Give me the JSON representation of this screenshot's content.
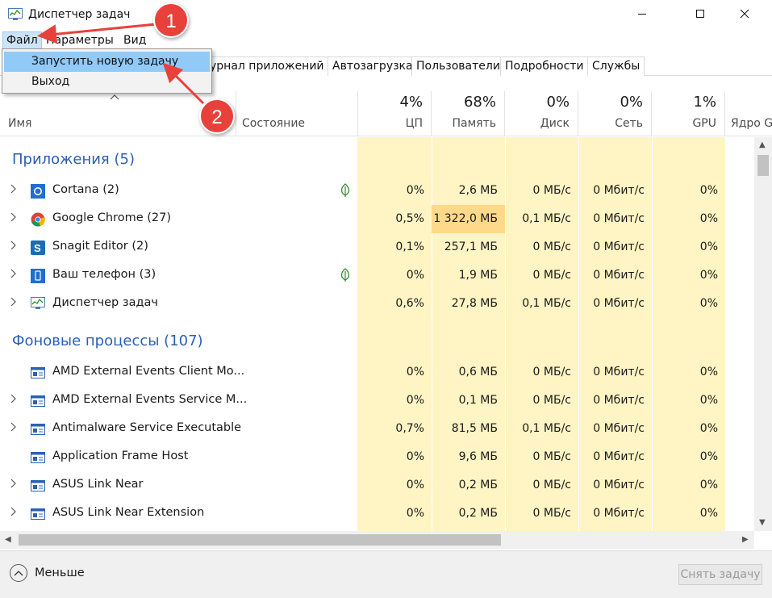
{
  "window": {
    "title": "Диспетчер задач",
    "controls": {
      "minimize": "minimize-icon",
      "maximize": "maximize-icon",
      "close": "close-icon"
    }
  },
  "menu": {
    "items": [
      "Файл",
      "Параметры",
      "Вид"
    ],
    "active_index": 0,
    "dropdown": [
      {
        "label": "Запустить новую задачу",
        "highlighted": true
      },
      {
        "label": "Выход",
        "highlighted": false
      }
    ]
  },
  "tabs": [
    "урнал приложений",
    "Автозагрузка",
    "Пользователи",
    "Подробности",
    "Службы"
  ],
  "columns": {
    "name": "Имя",
    "status": "Состояние",
    "cpu": {
      "percent": "4%",
      "label": "ЦП"
    },
    "memory": {
      "percent": "68%",
      "label": "Память"
    },
    "disk": {
      "percent": "0%",
      "label": "Диск"
    },
    "network": {
      "percent": "0%",
      "label": "Сеть"
    },
    "gpu": {
      "percent": "1%",
      "label": "GPU"
    },
    "gpu_engine": {
      "label": "Ядро GI"
    }
  },
  "groups": {
    "apps": "Приложения (5)",
    "background": "Фоновые процессы (107)"
  },
  "app_rows": [
    {
      "name": "Cortana (2)",
      "icon": "cortana-icon",
      "expandable": true,
      "leaf": true,
      "cpu": "0%",
      "mem": "2,6 МБ",
      "disk": "0 МБ/с",
      "net": "0 Мбит/с",
      "gpu": "0%"
    },
    {
      "name": "Google Chrome (27)",
      "icon": "chrome-icon",
      "expandable": true,
      "leaf": false,
      "cpu": "0,5%",
      "mem": "1 322,0 МБ",
      "disk": "0,1 МБ/с",
      "net": "0 Мбит/с",
      "gpu": "0%"
    },
    {
      "name": "Snagit Editor (2)",
      "icon": "snagit-icon",
      "expandable": true,
      "leaf": false,
      "cpu": "0,1%",
      "mem": "257,1 МБ",
      "disk": "0 МБ/с",
      "net": "0 Мбит/с",
      "gpu": "0%"
    },
    {
      "name": "Ваш телефон (3)",
      "icon": "phone-app-icon",
      "expandable": true,
      "leaf": true,
      "cpu": "0%",
      "mem": "1,9 МБ",
      "disk": "0 МБ/с",
      "net": "0 Мбит/с",
      "gpu": "0%"
    },
    {
      "name": "Диспетчер задач",
      "icon": "task-manager-icon",
      "expandable": true,
      "leaf": false,
      "cpu": "0,6%",
      "mem": "27,8 МБ",
      "disk": "0,1 МБ/с",
      "net": "0 Мбит/с",
      "gpu": "0%"
    }
  ],
  "bg_rows": [
    {
      "name": "AMD External Events Client Mo...",
      "icon": "process-icon",
      "expandable": false,
      "cpu": "0%",
      "mem": "0,6 МБ",
      "disk": "0 МБ/с",
      "net": "0 Мбит/с",
      "gpu": "0%"
    },
    {
      "name": "AMD External Events Service M...",
      "icon": "process-icon",
      "expandable": true,
      "cpu": "0%",
      "mem": "0,1 МБ",
      "disk": "0 МБ/с",
      "net": "0 Мбит/с",
      "gpu": "0%"
    },
    {
      "name": "Antimalware Service Executable",
      "icon": "process-icon",
      "expandable": true,
      "cpu": "0,7%",
      "mem": "81,5 МБ",
      "disk": "0,1 МБ/с",
      "net": "0 Мбит/с",
      "gpu": "0%"
    },
    {
      "name": "Application Frame Host",
      "icon": "process-icon",
      "expandable": false,
      "cpu": "0%",
      "mem": "9,6 МБ",
      "disk": "0 МБ/с",
      "net": "0 Мбит/с",
      "gpu": "0%"
    },
    {
      "name": "ASUS Link Near",
      "icon": "process-icon",
      "expandable": true,
      "cpu": "0%",
      "mem": "0,2 МБ",
      "disk": "0 МБ/с",
      "net": "0 Мбит/с",
      "gpu": "0%"
    },
    {
      "name": "ASUS Link Near Extension",
      "icon": "process-icon",
      "expandable": true,
      "cpu": "0%",
      "mem": "0,2 МБ",
      "disk": "0 МБ/с",
      "net": "0 Мбит/с",
      "gpu": "0%"
    }
  ],
  "footer": {
    "less_label": "Меньше",
    "end_task_label": "Снять задачу"
  },
  "annotations": {
    "badge1": "1",
    "badge2": "2"
  },
  "colors": {
    "heat_light": "#fff4c4",
    "heat_hot": "#ffd98a",
    "group_text": "#2b5fb4",
    "menu_highlight": "#91c9f7",
    "annotation_red": "#e8413c"
  }
}
